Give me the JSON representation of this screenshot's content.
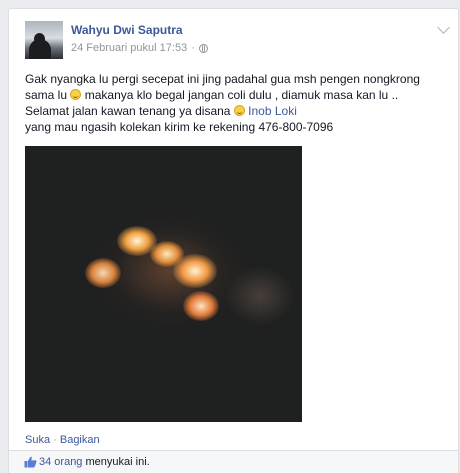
{
  "post": {
    "author": "Wahyu Dwi Saputra",
    "timestamp": "24 Februari pukul 17:53",
    "separator": "·",
    "privacy_icon": "globe-icon",
    "options_icon": "chevron-down-icon",
    "text": {
      "line1": "Gak nyangka lu pergi secepat ini jing padahal gua msh pengen nongkrong",
      "line2_a": "sama lu",
      "line2_b": "makanya klo begal jangan coli dulu , diamuk masa kan lu ..",
      "line3_a": "Selamat jalan kawan tenang ya disana",
      "line3_tag": "Inob Loki",
      "line4": "yang mau ngasih kolekan kirim ke rekening 476-800-7096"
    },
    "emoticon": "smiley-icon"
  },
  "actions": {
    "like": "Suka",
    "separator": " · ",
    "share": "Bagikan"
  },
  "likes": {
    "icon": "thumbs-up-icon",
    "count": "34 orang",
    "suffix": " menyukai ini."
  },
  "colors": {
    "link": "#3b5998",
    "meta": "#90949c",
    "background": "#e9ebee"
  }
}
